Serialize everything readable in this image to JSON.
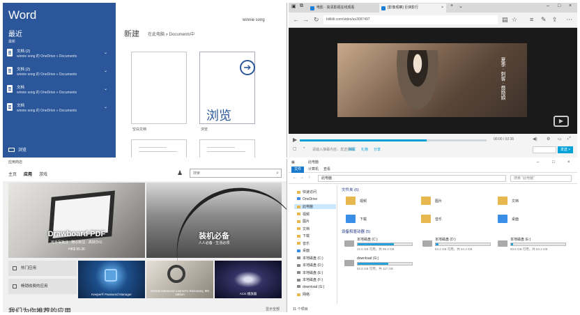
{
  "word": {
    "app_title": "Word",
    "recent_heading": "最近",
    "recent_sub": "最新",
    "recent_items": [
      {
        "name": "文档 (2)",
        "path": "winnie song 的 OneDrive » Documents"
      },
      {
        "name": "文档 (2)",
        "path": "winnie song 的 OneDrive » Documents"
      },
      {
        "name": "文档",
        "path": "winnie song 的 OneDrive » Documents"
      },
      {
        "name": "文档",
        "path": "winnie song 的 OneDrive » Documents"
      }
    ],
    "open_label": "浏览",
    "new_heading": "新建",
    "new_location": "在此电脑 » Documents中",
    "user_name": "winnie song",
    "template_blank_label": "空白文档",
    "template_browse_label": "浏览",
    "browse_text": "浏览"
  },
  "browser": {
    "tabs": [
      {
        "label": "电影 · 高清影视在线观看"
      },
      {
        "label": "[影像观察] 巨侠影行"
      }
    ],
    "url": "bilibili.com/video/av3097497",
    "time": "00:00 / 02:36",
    "danmu_placeholder": "请输入弹幕内容，发送弹幕",
    "tags": [
      "弹幕",
      "礼物",
      "分享"
    ],
    "send_label": "发送 >",
    "subtitle": "夏季 · 刺客 · 聂隐娘",
    "progress": 0.68
  },
  "store": {
    "window_title": "应用商店",
    "nav": [
      "主页",
      "应用",
      "游戏"
    ],
    "search_placeholder": "搜索",
    "hero1": {
      "title": "Drawboard PDF",
      "sub": "可手写批注 · 随心标注 · 高效办公",
      "price": "HK$ 95.30"
    },
    "hero2": {
      "title": "装机必备",
      "sub": "人人必备 · 生活必须"
    },
    "links": [
      "热门应用",
      "畅销收费的应用"
    ],
    "tiles": [
      "Keeper® Password Manager",
      "Oxford Advanced Learner's Dictionary, 8th edition",
      "ACG 播放器"
    ],
    "shelf_title": "我们为你推荐的应用",
    "shelf_more": "显示全部"
  },
  "explorer": {
    "window_title": "此电脑",
    "ribbon": [
      "文件",
      "计算机",
      "查看"
    ],
    "address": "此电脑",
    "search_placeholder": "搜索 \"此电脑\"",
    "nav_items": [
      "快速访问",
      "OneDrive",
      "此电脑",
      "视频",
      "图片",
      "文档",
      "下载",
      "音乐",
      "桌面",
      "本地磁盘 (C:)",
      "本地磁盘 (D:)",
      "本地磁盘 (E:)",
      "本地磁盘 (F:)",
      "download (G:)",
      "网络"
    ],
    "folders_heading": "文件夹 (6)",
    "folders": [
      "视频",
      "图片",
      "文档",
      "下载",
      "音乐",
      "桌面"
    ],
    "devices_heading": "设备和驱动器 (5)",
    "drives": [
      {
        "name": "本地磁盘 (C:)",
        "size": "32.6 GB 可用，共 99.2 GB",
        "used": 0.67
      },
      {
        "name": "本地磁盘 (D:)",
        "size": "83.2 GB 可用，共 84.2 GB",
        "used": 0.05
      },
      {
        "name": "本地磁盘 (E:)",
        "size": "83.6 GB 可用，共 84.2 GB",
        "used": 0.04
      },
      {
        "name": "download (G:)",
        "size": "50.8 GB 可用，共 117 GB",
        "used": 0.57
      }
    ],
    "status": "11 个项目"
  }
}
